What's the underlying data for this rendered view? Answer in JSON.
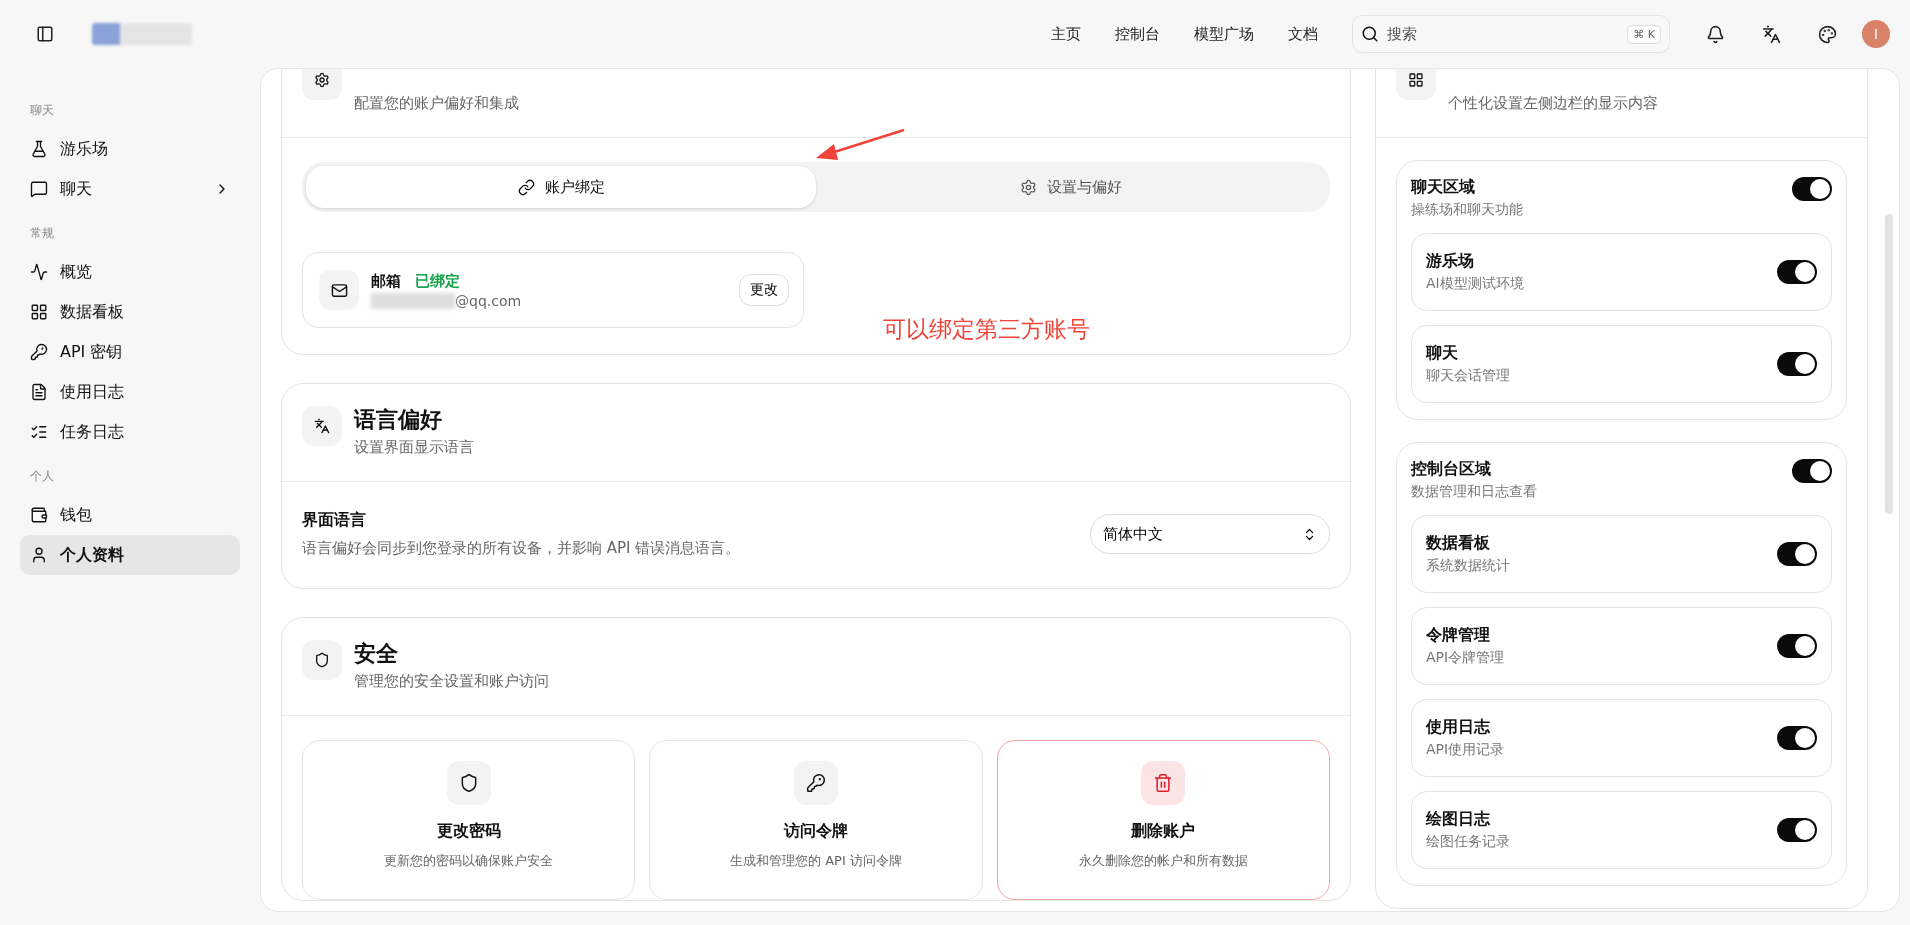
{
  "topbar": {
    "nav": [
      {
        "label": "主页"
      },
      {
        "label": "控制台"
      },
      {
        "label": "模型广场"
      },
      {
        "label": "文档"
      }
    ],
    "search": {
      "placeholder": "搜索",
      "shortcut": [
        "⌘",
        "K"
      ]
    },
    "avatar": "I"
  },
  "sidebar": {
    "sections": [
      {
        "title": "聊天",
        "items": [
          {
            "label": "游乐场",
            "selected": false,
            "expandable": false
          },
          {
            "label": "聊天",
            "selected": false,
            "expandable": true
          }
        ]
      },
      {
        "title": "常规",
        "items": [
          {
            "label": "概览",
            "selected": false,
            "expandable": false
          },
          {
            "label": "数据看板",
            "selected": false,
            "expandable": false
          },
          {
            "label": "API 密钥",
            "selected": false,
            "expandable": false
          },
          {
            "label": "使用日志",
            "selected": false,
            "expandable": false
          },
          {
            "label": "任务日志",
            "selected": false,
            "expandable": false
          }
        ]
      },
      {
        "title": "个人",
        "items": [
          {
            "label": "钱包",
            "selected": false,
            "expandable": false
          },
          {
            "label": "个人资料",
            "selected": true,
            "expandable": false
          }
        ]
      }
    ]
  },
  "settings_card": {
    "subtitle": "配置您的账户偏好和集成",
    "tabs": [
      {
        "label": "账户绑定",
        "selected": true
      },
      {
        "label": "设置与偏好",
        "selected": false
      }
    ],
    "binding": {
      "label": "邮箱",
      "status": "已绑定",
      "email": "@qq.com",
      "button": "更改"
    }
  },
  "annotation": {
    "text": "可以绑定第三方账号"
  },
  "language_card": {
    "title": "语言偏好",
    "subtitle": "设置界面显示语言",
    "label": "界面语言",
    "description": "语言偏好会同步到您登录的所有设备，并影响 API 错误消息语言。",
    "value": "简体中文"
  },
  "security_card": {
    "title": "安全",
    "subtitle": "管理您的安全设置和账户访问",
    "actions": [
      {
        "title": "更改密码",
        "description": "更新您的密码以确保账户安全",
        "danger": false
      },
      {
        "title": "访问令牌",
        "description": "生成和管理您的 API 访问令牌",
        "danger": false
      },
      {
        "title": "删除账户",
        "description": "永久删除您的帐户和所有数据",
        "danger": true
      }
    ]
  },
  "sidebar_settings": {
    "subtitle": "个性化设置左侧边栏的显示内容",
    "groups": [
      {
        "title": "聊天区域",
        "description": "操练场和聊天功能",
        "on": true,
        "items": [
          {
            "title": "游乐场",
            "description": "AI模型测试环境",
            "on": true
          },
          {
            "title": "聊天",
            "description": "聊天会话管理",
            "on": true
          }
        ]
      },
      {
        "title": "控制台区域",
        "description": "数据管理和日志查看",
        "on": true,
        "items": [
          {
            "title": "数据看板",
            "description": "系统数据统计",
            "on": true
          },
          {
            "title": "令牌管理",
            "description": "API令牌管理",
            "on": true
          },
          {
            "title": "使用日志",
            "description": "API使用记录",
            "on": true
          },
          {
            "title": "绘图日志",
            "description": "绘图任务记录",
            "on": true
          }
        ]
      }
    ]
  }
}
